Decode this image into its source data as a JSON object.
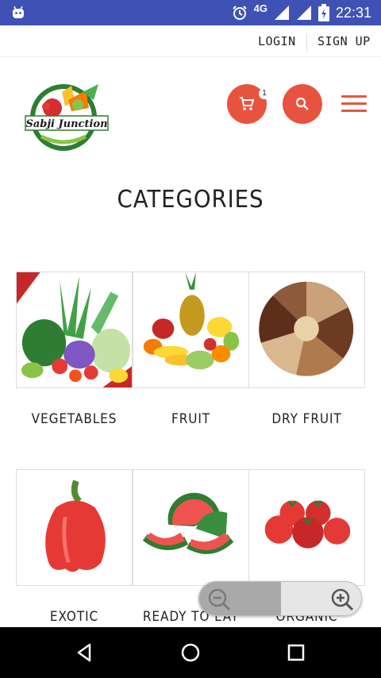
{
  "status_bar": {
    "network": "4G",
    "time": "22:31",
    "bg_color": "#3f51b5",
    "icons": [
      "android-icon",
      "alarm-icon",
      "signal-icon",
      "signal-icon",
      "battery-icon"
    ]
  },
  "top_links": {
    "login": "LOGIN",
    "signup": "SIGN UP"
  },
  "header": {
    "logo_text": "Sabji Junction",
    "cart_count": "1",
    "accent_color": "#e8533f",
    "icons": [
      "cart-icon",
      "search-icon",
      "hamburger-menu-icon"
    ]
  },
  "page": {
    "title": "CATEGORIES"
  },
  "categories": [
    {
      "label": "VEGETABLES",
      "icon": "vegetables-image"
    },
    {
      "label": "FRUIT",
      "icon": "fruit-image"
    },
    {
      "label": "DRY FRUIT",
      "icon": "dry-fruit-image"
    },
    {
      "label": "EXOTIC",
      "icon": "exotic-image"
    },
    {
      "label": "READY TO EAT",
      "icon": "ready-to-eat-image"
    },
    {
      "label": "ORGANIC",
      "icon": "organic-image"
    }
  ],
  "zoom_control": {
    "icons": [
      "zoom-out-icon",
      "zoom-in-icon"
    ]
  },
  "nav_bar": {
    "icons": [
      "back-icon",
      "home-icon",
      "recents-icon"
    ]
  }
}
